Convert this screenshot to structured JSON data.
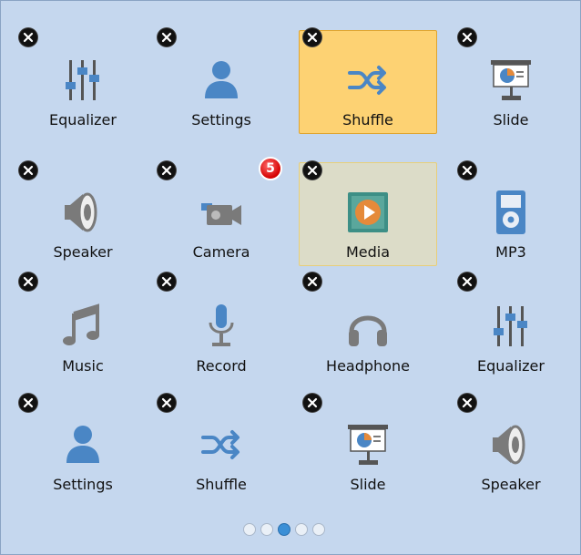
{
  "tiles": [
    {
      "label": "Equalizer",
      "icon": "equalizer-icon",
      "state": "normal"
    },
    {
      "label": "Settings",
      "icon": "user-icon",
      "state": "normal"
    },
    {
      "label": "Shuffle",
      "icon": "shuffle-icon",
      "state": "selected"
    },
    {
      "label": "Slide",
      "icon": "presentation-icon",
      "state": "normal"
    },
    {
      "label": "Speaker",
      "icon": "speaker-icon",
      "state": "normal"
    },
    {
      "label": "Camera",
      "icon": "video-camera-icon",
      "state": "normal",
      "badge": "5"
    },
    {
      "label": "Media",
      "icon": "play-icon",
      "state": "hovered"
    },
    {
      "label": "MP3",
      "icon": "mp3-player-icon",
      "state": "normal"
    },
    {
      "label": "Music",
      "icon": "music-note-icon",
      "state": "normal"
    },
    {
      "label": "Record",
      "icon": "microphone-icon",
      "state": "normal"
    },
    {
      "label": "Headphone",
      "icon": "headphones-icon",
      "state": "normal"
    },
    {
      "label": "Equalizer",
      "icon": "equalizer-icon",
      "state": "normal"
    },
    {
      "label": "Settings",
      "icon": "user-icon",
      "state": "normal"
    },
    {
      "label": "Shuffle",
      "icon": "shuffle-icon",
      "state": "normal"
    },
    {
      "label": "Slide",
      "icon": "presentation-icon",
      "state": "normal"
    },
    {
      "label": "Speaker",
      "icon": "speaker-icon",
      "state": "normal"
    }
  ],
  "close_label": "X",
  "pager": {
    "pages": 5,
    "current": 3
  },
  "colors": {
    "background": "#c5d7ee",
    "icon_blue": "#4a86c5",
    "icon_gray": "#7a7a7a",
    "selected_tile": "#fdd273",
    "hovered_tile": "#dcdcc8",
    "badge_red": "#d40000",
    "active_dot": "#3b8fd6"
  }
}
